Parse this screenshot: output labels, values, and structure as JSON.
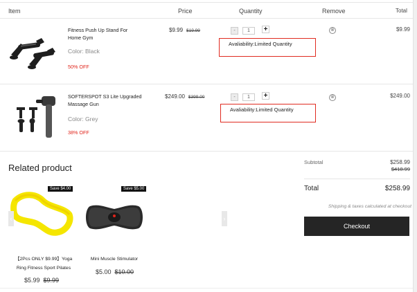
{
  "header": {
    "item": "Item",
    "price": "Price",
    "quantity": "Quantity",
    "remove": "Remove",
    "total": "Total"
  },
  "cart": {
    "items": [
      {
        "name": "Fitness Push Up Stand For Home Gym",
        "color": "Color: Black",
        "discount": "50% OFF",
        "price": "$9.99",
        "compare_price": "$19.99",
        "quantity": "1",
        "availability": "Avaliability:Limited Quantity",
        "total": "$9.99"
      },
      {
        "name": "SOFTERSPOT S3 Lite Upgraded Massage Gun",
        "color": "Color: Grey",
        "discount": "38% OFF",
        "price": "$249.00",
        "compare_price": "$399.00",
        "quantity": "1",
        "availability": "Avaliability:Limited Quantity",
        "total": "$249.00"
      }
    ],
    "qty_minus": "-",
    "qty_plus": "+",
    "remove_glyph": "⊗"
  },
  "related": {
    "title": "Related product",
    "products": [
      {
        "badge": "Save $4.00",
        "name_line1": "【2Pcs ONLY $9.99】Yoga",
        "name_line2": "Ring Fitness Sport Pilates",
        "price": "$5.99",
        "compare_price": "$9.99"
      },
      {
        "badge": "Save $5.00",
        "name": "Mini Muscle Stimulator",
        "price": "$5.00",
        "compare_price": "$10.00"
      }
    ],
    "prev_glyph": "‹",
    "next_glyph": "›"
  },
  "summary": {
    "subtotal_label": "Subtotal",
    "subtotal_value": "$258.99",
    "subtotal_compare": "$418.99",
    "total_label": "Total",
    "total_value": "$258.99",
    "shipping_note": "Shipping & taxes calculated at checkout",
    "checkout_label": "Checkout"
  },
  "colors": {
    "accent_red": "#e0241b",
    "checkout_bg": "#252525",
    "badge_bg": "#111111"
  }
}
